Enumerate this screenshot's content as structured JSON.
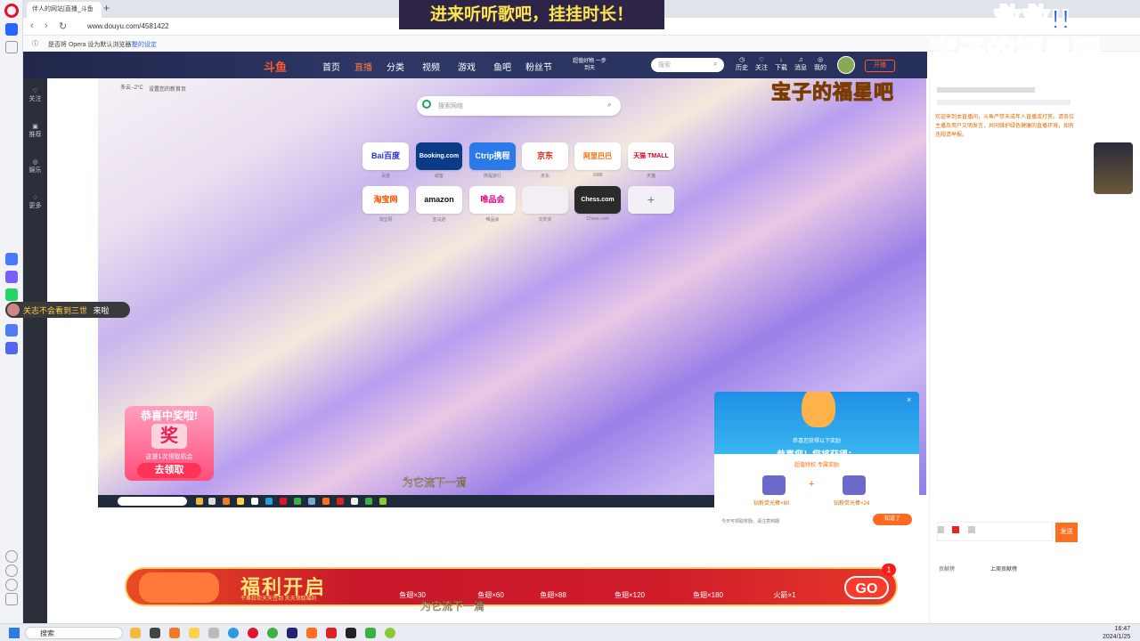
{
  "browser": {
    "tab_title": "伴人的网站|直播_斗鱼",
    "url": "www.douyu.com/4581422",
    "infobar_text": "是否将 Opera 设为默认浏览器？",
    "infobar_link": "是的设定"
  },
  "stream_title": "进来听听歌吧，挂挂时长！",
  "overlay": {
    "line1": "救救!!",
    "line2": "宝子的福星吧",
    "caption": "宝子的福星吧"
  },
  "header": {
    "logo": "斗鱼",
    "nav": [
      "首页",
      "直播",
      "分类",
      "视频",
      "游戏",
      "鱼吧",
      "粉丝节"
    ],
    "promo": "超值好物 一步到天",
    "search_placeholder": "搜索",
    "icons": [
      "历史",
      "关注",
      "下载",
      "消息",
      "我的",
      "个人中心"
    ],
    "live_btn": "开播"
  },
  "dy_left": [
    "关注",
    "推荐",
    "娱乐",
    "更多"
  ],
  "video": {
    "weather": "多云 -2°C",
    "tip": "设置您的新首页",
    "search_placeholder": "搜索网络",
    "tiles": [
      {
        "name": "Bai百度",
        "label": "百度",
        "color": "#2932e1"
      },
      {
        "name": "Booking.com",
        "label": "缤客",
        "color": "#fff",
        "bg": "#0b3a86"
      },
      {
        "name": "Ctrip携程",
        "label": "携程旅行",
        "color": "#fff",
        "bg": "#2a7be9"
      },
      {
        "name": "京东",
        "label": "京东",
        "color": "#e1251b"
      },
      {
        "name": "阿里巴巴",
        "label": "1688",
        "color": "#ff6a00"
      },
      {
        "name": "天猫 TMALL",
        "label": "天猫",
        "color": "#d6001c"
      },
      {
        "name": "淘宝网",
        "label": "淘宝网",
        "color": "#ff5000"
      },
      {
        "name": "amazon",
        "label": "亚马逊",
        "color": "#111"
      },
      {
        "name": "唯品会",
        "label": "唯品会",
        "color": "#e6007e"
      },
      {
        "name": "",
        "label": "文件夹",
        "color": "#666"
      },
      {
        "name": "Chess.com",
        "label": "Chess.com",
        "color": "#fff",
        "bg": "#2a2a2a"
      },
      {
        "name": "+",
        "label": "",
        "color": "#777"
      }
    ],
    "subtitle": "为它流下一滴"
  },
  "popup": {
    "head": "恭喜您获得以下奖励",
    "title": "恭喜您！您将获得：",
    "sub": "超值特权·专属奖励",
    "reward1": "钻粉荧光棒×80",
    "reward2": "钻粉荧光棒×24",
    "footer": "今天可领取奖励，请注意到期",
    "btn": "知道了"
  },
  "chat": {
    "message": "欢迎来到本直播间，斗鱼严禁未成年人直播或打赏。请各位主播及用户文明发言，共同维护绿色健康的直播环境，如有违规请举报。",
    "send": "发送",
    "tab1": "贡献榜",
    "tab2": "上周贡献榜"
  },
  "prize": {
    "title": "恭喜中奖啦!",
    "mid": "奖",
    "line": "这是1次领取机会",
    "btn": "去领取"
  },
  "follow_toast": {
    "name": "关志不会看到三世",
    "action": "来啦"
  },
  "banner": {
    "title": "福利开启",
    "sub": "千鱼狂欢天天签到 天天领取福利",
    "items": [
      "鱼翅×30",
      "鱼翅×60",
      "鱼翅×88",
      "鱼翅×120",
      "鱼翅×180",
      "火箭×1"
    ],
    "go": "GO",
    "badge": "1"
  },
  "bottom_subtitle": "为它流下一滴",
  "taskbar": {
    "search": "搜索",
    "time": "16:47",
    "date": "2024/1/25"
  }
}
